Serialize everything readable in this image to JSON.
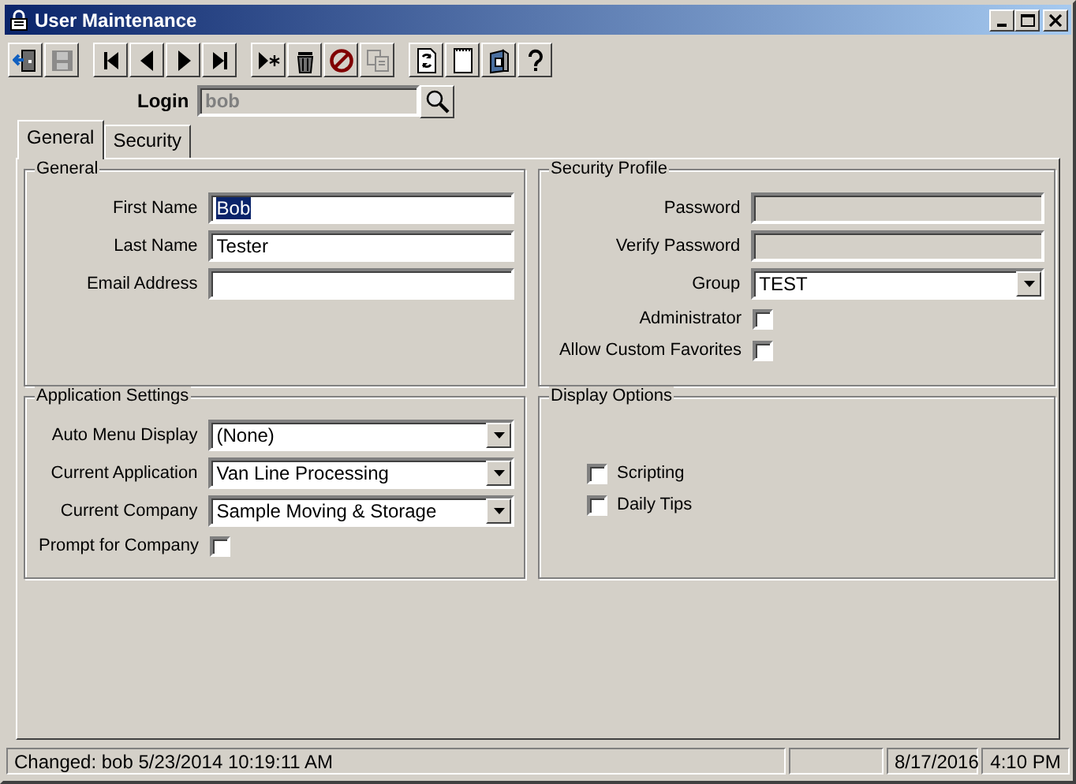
{
  "window": {
    "title": "User Maintenance"
  },
  "toolbar": {
    "buttons": [
      {
        "kind": "exit",
        "disabled": false
      },
      {
        "kind": "save",
        "disabled": true
      },
      {
        "kind": "first",
        "disabled": false
      },
      {
        "kind": "prev",
        "disabled": false
      },
      {
        "kind": "next",
        "disabled": false
      },
      {
        "kind": "last",
        "disabled": false
      },
      {
        "kind": "new",
        "disabled": false
      },
      {
        "kind": "delete",
        "disabled": false
      },
      {
        "kind": "cancel",
        "disabled": false
      },
      {
        "kind": "copy",
        "disabled": true
      },
      {
        "kind": "refresh",
        "disabled": false
      },
      {
        "kind": "page",
        "disabled": false
      },
      {
        "kind": "binder",
        "disabled": false
      },
      {
        "kind": "help",
        "disabled": false
      }
    ]
  },
  "login": {
    "label": "Login",
    "value": "bob",
    "disabled": true
  },
  "tabs": [
    {
      "label": "General",
      "selected": true
    },
    {
      "label": "Security",
      "selected": false
    }
  ],
  "groups": [
    {
      "title": "General",
      "rows": [
        {
          "kind": "text",
          "label": "First Name",
          "value": "Bob",
          "value_selected": true,
          "disabled": false
        },
        {
          "kind": "text",
          "label": "Last Name",
          "value": "Tester",
          "value_selected": false,
          "disabled": false
        },
        {
          "kind": "text",
          "label": "Email Address",
          "disabled": false
        }
      ]
    },
    {
      "title": "Security Profile",
      "rows": [
        {
          "kind": "text",
          "label": "Password",
          "disabled": true
        },
        {
          "kind": "text",
          "label": "Verify Password",
          "disabled": true
        },
        {
          "kind": "dropdown",
          "label": "Group",
          "value": "TEST"
        },
        {
          "kind": "checkbox",
          "label": "Administrator",
          "checked": false
        },
        {
          "kind": "checkbox",
          "label": "Allow Custom Favorites",
          "checked": false
        }
      ]
    },
    {
      "title": "Application Settings",
      "rows": [
        {
          "kind": "dropdown",
          "label": "Auto Menu Display",
          "value": "(None)"
        },
        {
          "kind": "dropdown",
          "label": "Current Application",
          "value": "Van Line Processing"
        },
        {
          "kind": "dropdown",
          "label": "Current Company",
          "value": "Sample Moving & Storage"
        },
        {
          "kind": "checkbox",
          "label": "Prompt for Company",
          "checked": false
        }
      ]
    },
    {
      "title": "Display Options",
      "rows": [
        {
          "kind": "option",
          "label": "Scripting",
          "checked": false
        },
        {
          "kind": "option",
          "label": "Daily Tips",
          "checked": false
        }
      ]
    }
  ],
  "status_bar": {
    "message": "Changed: bob 5/23/2014 10:19:11 AM",
    "date": "8/17/2016",
    "time": "4:10 PM"
  }
}
